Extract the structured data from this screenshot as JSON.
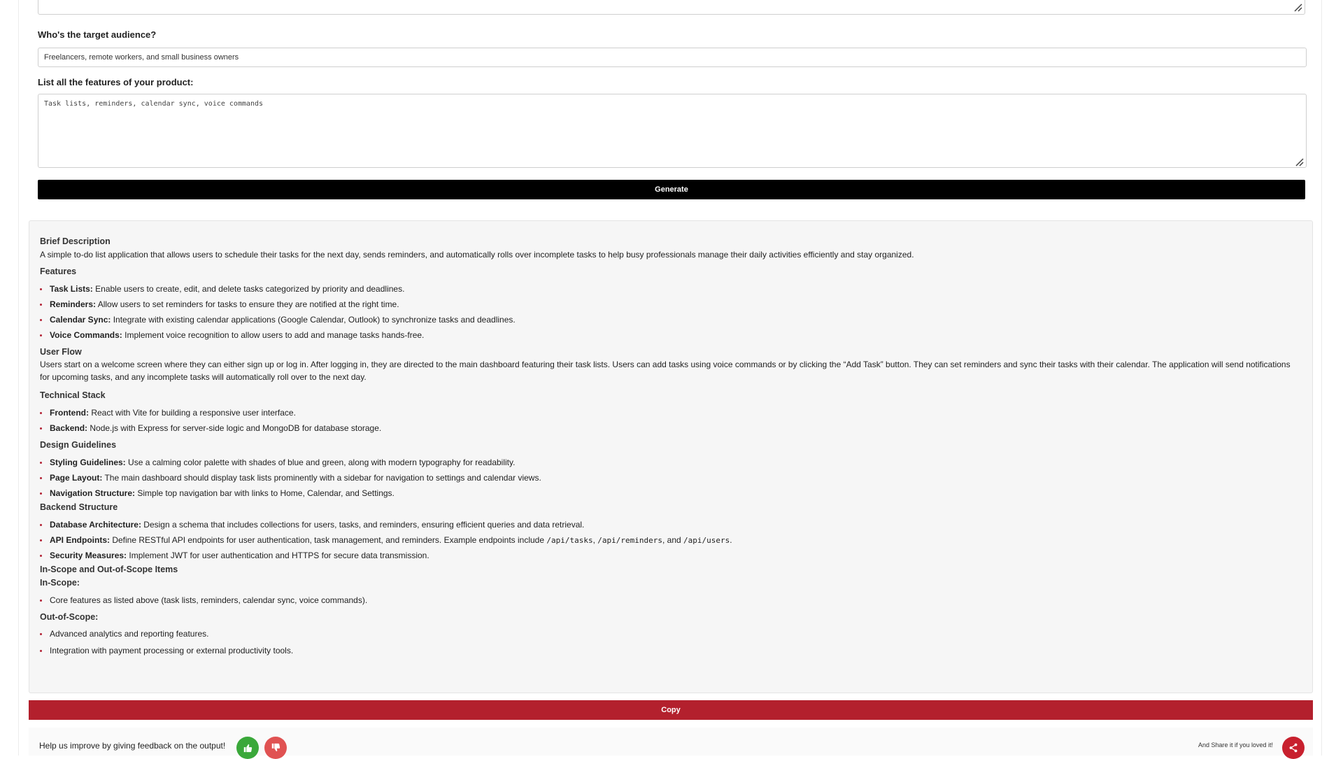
{
  "form": {
    "audience_label": "Who's the target audience?",
    "audience_value": "Freelancers, remote workers, and small business owners",
    "features_label": "List all the features of your product:",
    "features_value": "Task lists, reminders, calendar sync, voice commands",
    "generate_label": "Generate"
  },
  "output": {
    "brief_heading": "Brief Description",
    "brief_text": "A simple to-do list application that allows users to schedule their tasks for the next day, sends reminders, and automatically rolls over incomplete tasks to help busy professionals manage their daily activities efficiently and stay organized.",
    "features_heading": "Features",
    "features": [
      {
        "term": "Task Lists:",
        "text": " Enable users to create, edit, and delete tasks categorized by priority and deadlines."
      },
      {
        "term": "Reminders:",
        "text": " Allow users to set reminders for tasks to ensure they are notified at the right time."
      },
      {
        "term": "Calendar Sync:",
        "text": " Integrate with existing calendar applications (Google Calendar, Outlook) to synchronize tasks and deadlines."
      },
      {
        "term": "Voice Commands:",
        "text": " Implement voice recognition to allow users to add and manage tasks hands-free."
      }
    ],
    "flow_heading": "User Flow",
    "flow_text": "Users start on a welcome screen where they can either sign up or log in. After logging in, they are directed to the main dashboard featuring their task lists. Users can add tasks using voice commands or by clicking the “Add Task” button. They can set reminders and sync their tasks with their calendar. The application will send notifications for upcoming tasks, and any incomplete tasks will automatically roll over to the next day.",
    "stack_heading": "Technical Stack",
    "stack": [
      {
        "term": "Frontend:",
        "text": " React with Vite for building a responsive user interface."
      },
      {
        "term": "Backend:",
        "text": " Node.js with Express for server-side logic and MongoDB for database storage."
      }
    ],
    "design_heading": "Design Guidelines",
    "design": [
      {
        "term": "Styling Guidelines:",
        "text": " Use a calming color palette with shades of blue and green, along with modern typography for readability."
      },
      {
        "term": "Page Layout:",
        "text": " The main dashboard should display task lists prominently with a sidebar for navigation to settings and calendar views."
      },
      {
        "term": "Navigation Structure:",
        "text": " Simple top navigation bar with links to Home, Calendar, and Settings."
      }
    ],
    "backend_heading": "Backend Structure",
    "backend": {
      "db_term": "Database Architecture:",
      "db_text": " Design a schema that includes collections for users, tasks, and reminders, ensuring efficient queries and data retrieval.",
      "api_term": "API Endpoints:",
      "api_text": " Define RESTful API endpoints for user authentication, task management, and reminders. Example endpoints include ",
      "api_code1": "/api/tasks",
      "api_sep1": ", ",
      "api_code2": "/api/reminders",
      "api_sep2": ", and ",
      "api_code3": "/api/users",
      "api_end": ".",
      "sec_term": "Security Measures:",
      "sec_text": " Implement JWT for user authentication and HTTPS for secure data transmission."
    },
    "scope_heading": "In-Scope and Out-of-Scope Items",
    "in_scope_label": "In-Scope:",
    "in_scope": [
      "Core features as listed above (task lists, reminders, calendar sync, voice commands)."
    ],
    "out_scope_label": "Out-of-Scope:",
    "out_scope": [
      "Advanced analytics and reporting features.",
      "Integration with payment processing or external productivity tools."
    ]
  },
  "copy_label": "Copy",
  "feedback": {
    "prompt": "Help us improve by giving feedback on the output!",
    "share_text": "And Share it if you loved it!",
    "like_color": "#3aa83a",
    "dislike_color": "#e05252",
    "share_color": "#c8202e",
    "like_icon": "thumbs-up-icon",
    "dislike_icon": "thumbs-down-icon",
    "share_icon": "share-icon"
  }
}
